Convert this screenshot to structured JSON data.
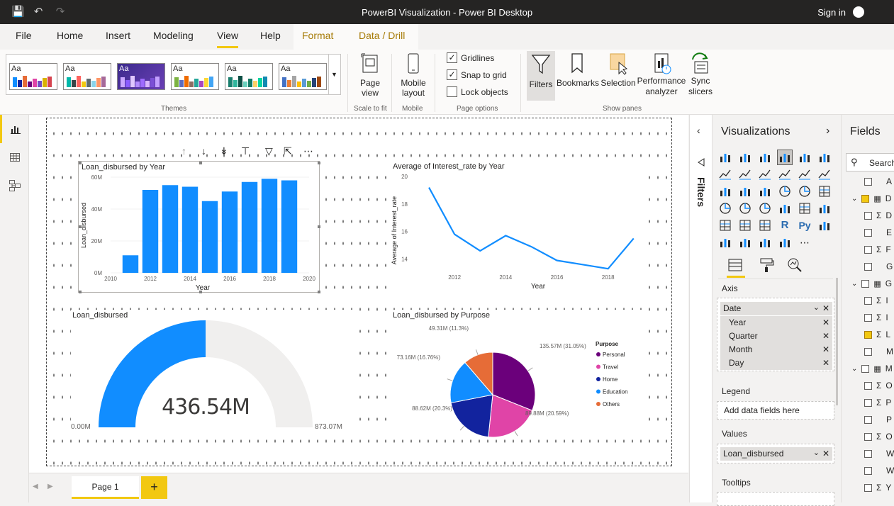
{
  "window": {
    "title": "PowerBI Visualization - Power BI Desktop",
    "sign_in": "Sign in"
  },
  "menu": {
    "tabs": [
      "File",
      "Home",
      "Insert",
      "Modeling",
      "View",
      "Help",
      "Format",
      "Data / Drill"
    ],
    "active": "View"
  },
  "ribbon": {
    "themes_label": "Themes",
    "theme_sample_text": "Aa",
    "page_view": "Page view",
    "scale_label": "Scale to fit",
    "mobile_layout": "Mobile layout",
    "mobile_label": "Mobile",
    "gridlines": "Gridlines",
    "snap_to_grid": "Snap to grid",
    "lock_objects": "Lock objects",
    "page_options_label": "Page options",
    "filters": "Filters",
    "bookmarks": "Bookmarks",
    "selection": "Selection",
    "performance_analyzer": "Performance analyzer",
    "sync_slicers": "Sync slicers",
    "show_panes_label": "Show panes",
    "gridlines_checked": true,
    "snap_checked": true,
    "lock_checked": false
  },
  "visuals": {
    "bar": {
      "title": "Loan_disbursed by Year",
      "chart_data": {
        "type": "bar",
        "title": "Loan_disbursed by Year",
        "xlabel": "Year",
        "ylabel": "Loan_disbursed",
        "x": [
          2011,
          2012,
          2013,
          2014,
          2015,
          2016,
          2017,
          2018,
          2019
        ],
        "values": [
          11,
          52,
          55,
          54,
          45,
          51,
          57,
          59,
          58
        ],
        "yunit": "M",
        "ylim": [
          0,
          60
        ],
        "yticks": [
          "0M",
          "20M",
          "40M",
          "60M"
        ],
        "xticks": [
          "2010",
          "2012",
          "2014",
          "2016",
          "2018",
          "2020"
        ],
        "color": "#118dff"
      }
    },
    "line": {
      "title": "Average of Interest_rate by Year",
      "chart_data": {
        "type": "line",
        "title": "Average of Interest_rate by Year",
        "xlabel": "Year",
        "ylabel": "Average of Interest_rate",
        "x": [
          2011,
          2012,
          2013,
          2014,
          2015,
          2016,
          2017,
          2018,
          2019
        ],
        "values": [
          19.2,
          15.8,
          14.6,
          15.7,
          14.9,
          13.9,
          13.6,
          13.3,
          15.5
        ],
        "ylim": [
          13,
          20
        ],
        "yticks": [
          "14",
          "16",
          "18",
          "20"
        ],
        "xticks": [
          "2012",
          "2014",
          "2016",
          "2018"
        ],
        "color": "#118dff"
      }
    },
    "gauge": {
      "title": "Loan_disbursed",
      "value_label": "436.54M",
      "min_label": "0.00M",
      "max_label": "873.07M",
      "value": 436.54,
      "max": 873.07,
      "color": "#118dff"
    },
    "pie": {
      "title": "Loan_disbursed by Purpose",
      "legend_title": "Purpose",
      "chart_data": {
        "type": "pie",
        "title": "Loan_disbursed by Purpose",
        "categories": [
          "Personal",
          "Travel",
          "Home",
          "Education",
          "Others"
        ],
        "values": [
          135.57,
          89.88,
          88.62,
          73.16,
          49.31
        ],
        "labels": [
          "135.57M (31.05%)",
          "89.88M (20.59%)",
          "88.62M (20.3%)",
          "73.16M (16.76%)",
          "49.31M (11.3%)"
        ],
        "colors": [
          "#6b007b",
          "#e044a7",
          "#12239e",
          "#118dff",
          "#e66c37"
        ],
        "legend": "right"
      }
    }
  },
  "page_tabs": {
    "current": "Page 1",
    "add": "+"
  },
  "filters_pane": {
    "label": "Filters"
  },
  "viz_pane": {
    "title": "Visualizations",
    "axis_label": "Axis",
    "axis_fields": [
      "Date",
      "Year",
      "Quarter",
      "Month",
      "Day"
    ],
    "legend_label": "Legend",
    "legend_placeholder": "Add data fields here",
    "values_label": "Values",
    "values_field": "Loan_disbursed",
    "tooltips_label": "Tooltips"
  },
  "fields_pane": {
    "title": "Fields",
    "search_placeholder": "Search",
    "rows": [
      {
        "indent": 1,
        "sigma": false,
        "checked": false,
        "text": "A"
      },
      {
        "indent": 0,
        "sigma": false,
        "checked": true,
        "text": "D",
        "table": true
      },
      {
        "indent": 1,
        "sigma": true,
        "checked": false,
        "text": "D"
      },
      {
        "indent": 1,
        "sigma": false,
        "checked": false,
        "text": "E"
      },
      {
        "indent": 1,
        "sigma": true,
        "checked": false,
        "text": "F"
      },
      {
        "indent": 1,
        "sigma": false,
        "checked": false,
        "text": "G"
      },
      {
        "indent": 0,
        "sigma": false,
        "checked": false,
        "text": "G",
        "table": true
      },
      {
        "indent": 1,
        "sigma": true,
        "checked": false,
        "text": "I"
      },
      {
        "indent": 1,
        "sigma": true,
        "checked": false,
        "text": "I"
      },
      {
        "indent": 1,
        "sigma": true,
        "checked": true,
        "text": "L"
      },
      {
        "indent": 1,
        "sigma": false,
        "checked": false,
        "text": "M"
      },
      {
        "indent": 0,
        "sigma": false,
        "checked": false,
        "text": "M",
        "table": true
      },
      {
        "indent": 1,
        "sigma": true,
        "checked": false,
        "text": "O"
      },
      {
        "indent": 1,
        "sigma": true,
        "checked": false,
        "text": "P"
      },
      {
        "indent": 1,
        "sigma": false,
        "checked": false,
        "text": "P"
      },
      {
        "indent": 1,
        "sigma": true,
        "checked": false,
        "text": "O"
      },
      {
        "indent": 1,
        "sigma": false,
        "checked": false,
        "text": "W"
      },
      {
        "indent": 1,
        "sigma": false,
        "checked": false,
        "text": "W"
      },
      {
        "indent": 1,
        "sigma": true,
        "checked": false,
        "text": "Y"
      }
    ]
  }
}
